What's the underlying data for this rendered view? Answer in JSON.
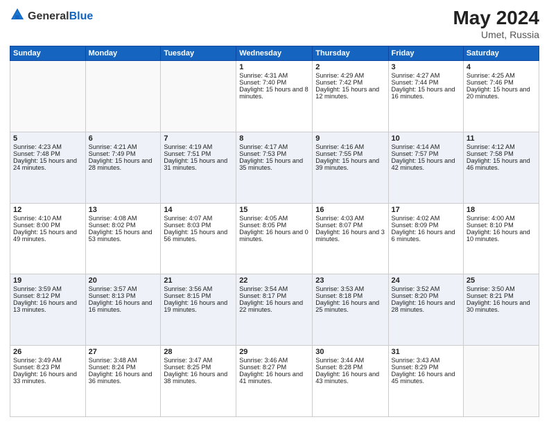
{
  "header": {
    "logo_general": "General",
    "logo_blue": "Blue",
    "title": "May 2024",
    "location": "Umet, Russia"
  },
  "days_of_week": [
    "Sunday",
    "Monday",
    "Tuesday",
    "Wednesday",
    "Thursday",
    "Friday",
    "Saturday"
  ],
  "weeks": [
    [
      {
        "day": "",
        "empty": true
      },
      {
        "day": "",
        "empty": true
      },
      {
        "day": "",
        "empty": true
      },
      {
        "day": "1",
        "sunrise": "4:31 AM",
        "sunset": "7:40 PM",
        "daylight": "15 hours and 8 minutes."
      },
      {
        "day": "2",
        "sunrise": "4:29 AM",
        "sunset": "7:42 PM",
        "daylight": "15 hours and 12 minutes."
      },
      {
        "day": "3",
        "sunrise": "4:27 AM",
        "sunset": "7:44 PM",
        "daylight": "15 hours and 16 minutes."
      },
      {
        "day": "4",
        "sunrise": "4:25 AM",
        "sunset": "7:46 PM",
        "daylight": "15 hours and 20 minutes."
      }
    ],
    [
      {
        "day": "5",
        "sunrise": "4:23 AM",
        "sunset": "7:48 PM",
        "daylight": "15 hours and 24 minutes."
      },
      {
        "day": "6",
        "sunrise": "4:21 AM",
        "sunset": "7:49 PM",
        "daylight": "15 hours and 28 minutes."
      },
      {
        "day": "7",
        "sunrise": "4:19 AM",
        "sunset": "7:51 PM",
        "daylight": "15 hours and 31 minutes."
      },
      {
        "day": "8",
        "sunrise": "4:17 AM",
        "sunset": "7:53 PM",
        "daylight": "15 hours and 35 minutes."
      },
      {
        "day": "9",
        "sunrise": "4:16 AM",
        "sunset": "7:55 PM",
        "daylight": "15 hours and 39 minutes."
      },
      {
        "day": "10",
        "sunrise": "4:14 AM",
        "sunset": "7:57 PM",
        "daylight": "15 hours and 42 minutes."
      },
      {
        "day": "11",
        "sunrise": "4:12 AM",
        "sunset": "7:58 PM",
        "daylight": "15 hours and 46 minutes."
      }
    ],
    [
      {
        "day": "12",
        "sunrise": "4:10 AM",
        "sunset": "8:00 PM",
        "daylight": "15 hours and 49 minutes."
      },
      {
        "day": "13",
        "sunrise": "4:08 AM",
        "sunset": "8:02 PM",
        "daylight": "15 hours and 53 minutes."
      },
      {
        "day": "14",
        "sunrise": "4:07 AM",
        "sunset": "8:03 PM",
        "daylight": "15 hours and 56 minutes."
      },
      {
        "day": "15",
        "sunrise": "4:05 AM",
        "sunset": "8:05 PM",
        "daylight": "16 hours and 0 minutes."
      },
      {
        "day": "16",
        "sunrise": "4:03 AM",
        "sunset": "8:07 PM",
        "daylight": "16 hours and 3 minutes."
      },
      {
        "day": "17",
        "sunrise": "4:02 AM",
        "sunset": "8:09 PM",
        "daylight": "16 hours and 6 minutes."
      },
      {
        "day": "18",
        "sunrise": "4:00 AM",
        "sunset": "8:10 PM",
        "daylight": "16 hours and 10 minutes."
      }
    ],
    [
      {
        "day": "19",
        "sunrise": "3:59 AM",
        "sunset": "8:12 PM",
        "daylight": "16 hours and 13 minutes."
      },
      {
        "day": "20",
        "sunrise": "3:57 AM",
        "sunset": "8:13 PM",
        "daylight": "16 hours and 16 minutes."
      },
      {
        "day": "21",
        "sunrise": "3:56 AM",
        "sunset": "8:15 PM",
        "daylight": "16 hours and 19 minutes."
      },
      {
        "day": "22",
        "sunrise": "3:54 AM",
        "sunset": "8:17 PM",
        "daylight": "16 hours and 22 minutes."
      },
      {
        "day": "23",
        "sunrise": "3:53 AM",
        "sunset": "8:18 PM",
        "daylight": "16 hours and 25 minutes."
      },
      {
        "day": "24",
        "sunrise": "3:52 AM",
        "sunset": "8:20 PM",
        "daylight": "16 hours and 28 minutes."
      },
      {
        "day": "25",
        "sunrise": "3:50 AM",
        "sunset": "8:21 PM",
        "daylight": "16 hours and 30 minutes."
      }
    ],
    [
      {
        "day": "26",
        "sunrise": "3:49 AM",
        "sunset": "8:23 PM",
        "daylight": "16 hours and 33 minutes."
      },
      {
        "day": "27",
        "sunrise": "3:48 AM",
        "sunset": "8:24 PM",
        "daylight": "16 hours and 36 minutes."
      },
      {
        "day": "28",
        "sunrise": "3:47 AM",
        "sunset": "8:25 PM",
        "daylight": "16 hours and 38 minutes."
      },
      {
        "day": "29",
        "sunrise": "3:46 AM",
        "sunset": "8:27 PM",
        "daylight": "16 hours and 41 minutes."
      },
      {
        "day": "30",
        "sunrise": "3:44 AM",
        "sunset": "8:28 PM",
        "daylight": "16 hours and 43 minutes."
      },
      {
        "day": "31",
        "sunrise": "3:43 AM",
        "sunset": "8:29 PM",
        "daylight": "16 hours and 45 minutes."
      },
      {
        "day": "",
        "empty": true
      }
    ]
  ],
  "labels": {
    "sunrise_prefix": "Sunrise: ",
    "sunset_prefix": "Sunset: ",
    "daylight_prefix": "Daylight: "
  }
}
